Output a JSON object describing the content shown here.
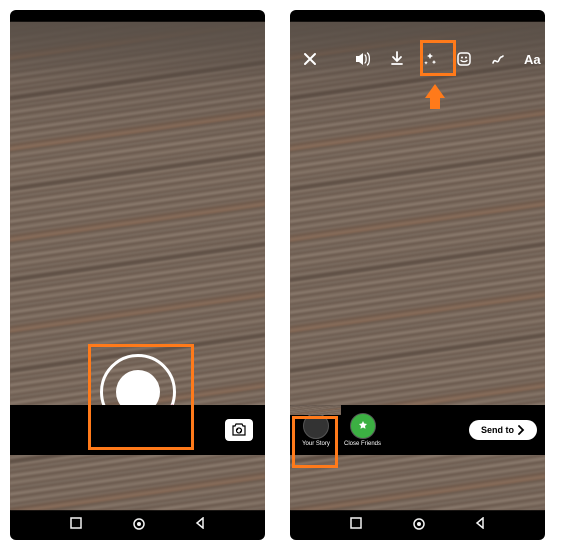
{
  "left": {
    "shutter_name": "shutter"
  },
  "right": {
    "toolbar": {
      "close": "close",
      "sound": "sound",
      "download": "download",
      "effects": "effects",
      "sticker": "sticker",
      "draw": "draw",
      "text_label": "Aa"
    },
    "stories": {
      "your_story": "Your Story",
      "close_friends": "Close Friends"
    },
    "send_label": "Send to"
  },
  "nav": {
    "recent": "recent",
    "home": "home",
    "back": "back"
  }
}
